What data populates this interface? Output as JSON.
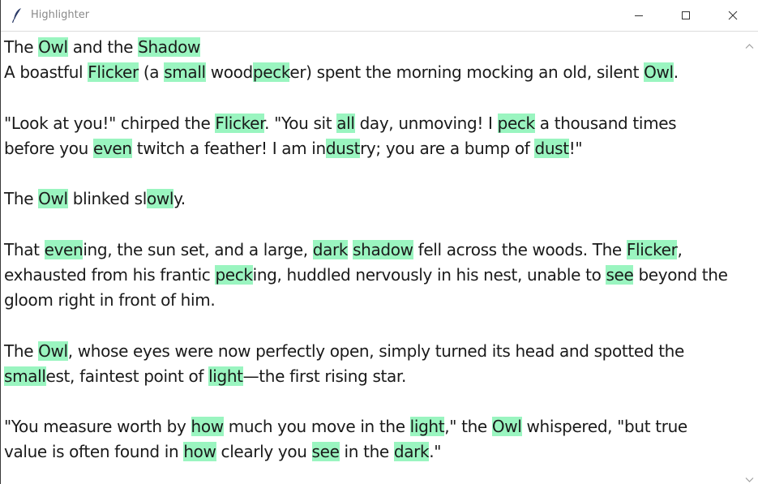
{
  "window": {
    "title": "Highlighter",
    "icon": "feather-icon",
    "highlight_color": "#9af5c0"
  },
  "lines": [
    {
      "segs": [
        {
          "t": "The ",
          "h": false
        },
        {
          "t": "Owl",
          "h": true
        },
        {
          "t": " and the ",
          "h": false
        },
        {
          "t": "Shadow",
          "h": true
        }
      ]
    },
    {
      "segs": [
        {
          "t": "A boastful ",
          "h": false
        },
        {
          "t": "Flicker",
          "h": true
        },
        {
          "t": " (a ",
          "h": false
        },
        {
          "t": "small",
          "h": true
        },
        {
          "t": " wood",
          "h": false
        },
        {
          "t": "peck",
          "h": true
        },
        {
          "t": "er) spent the morning mocking an old, silent ",
          "h": false
        },
        {
          "t": "Owl",
          "h": true
        },
        {
          "t": ".",
          "h": false
        }
      ]
    },
    {
      "segs": [
        {
          "t": "\"Look at you!\" chirped the ",
          "h": false
        },
        {
          "t": "Flicker",
          "h": true
        },
        {
          "t": ". \"You sit ",
          "h": false
        },
        {
          "t": "all",
          "h": true
        },
        {
          "t": " day, unmoving! I ",
          "h": false
        },
        {
          "t": "peck",
          "h": true
        },
        {
          "t": " a thousand times",
          "h": false
        }
      ]
    },
    {
      "segs": [
        {
          "t": "before you ",
          "h": false
        },
        {
          "t": "even",
          "h": true
        },
        {
          "t": " twitch a feather! I am in",
          "h": false
        },
        {
          "t": "dust",
          "h": true
        },
        {
          "t": "ry; you are a bump of ",
          "h": false
        },
        {
          "t": "dust",
          "h": true
        },
        {
          "t": "!\"",
          "h": false
        }
      ]
    },
    {
      "segs": [
        {
          "t": "The ",
          "h": false
        },
        {
          "t": "Owl",
          "h": true
        },
        {
          "t": " blinked sl",
          "h": false
        },
        {
          "t": "owl",
          "h": true
        },
        {
          "t": "y.",
          "h": false
        }
      ]
    },
    {
      "segs": [
        {
          "t": "That ",
          "h": false
        },
        {
          "t": "even",
          "h": true
        },
        {
          "t": "ing, the sun set, and a large, ",
          "h": false
        },
        {
          "t": "dark",
          "h": true
        },
        {
          "t": " ",
          "h": false
        },
        {
          "t": "shadow",
          "h": true
        },
        {
          "t": " fell across the woods. The ",
          "h": false
        },
        {
          "t": "Flicker",
          "h": true
        },
        {
          "t": ",",
          "h": false
        }
      ]
    },
    {
      "segs": [
        {
          "t": "exhausted from his frantic ",
          "h": false
        },
        {
          "t": "peck",
          "h": true
        },
        {
          "t": "ing, huddled nervously in his nest, unable to ",
          "h": false
        },
        {
          "t": "see",
          "h": true
        },
        {
          "t": " beyond the",
          "h": false
        }
      ]
    },
    {
      "segs": [
        {
          "t": "gloom right in front of him.",
          "h": false
        }
      ]
    },
    {
      "segs": [
        {
          "t": "The ",
          "h": false
        },
        {
          "t": "Owl",
          "h": true
        },
        {
          "t": ", whose eyes were now perfectly open, simply turned its head and spotted the",
          "h": false
        }
      ]
    },
    {
      "segs": [
        {
          "t": "small",
          "h": true
        },
        {
          "t": "est, faintest point of ",
          "h": false
        },
        {
          "t": "light",
          "h": true
        },
        {
          "t": "—the first rising star.",
          "h": false
        }
      ]
    },
    {
      "segs": [
        {
          "t": "\"You measure worth by ",
          "h": false
        },
        {
          "t": "how",
          "h": true
        },
        {
          "t": " much you move in the ",
          "h": false
        },
        {
          "t": "light",
          "h": true
        },
        {
          "t": ",\" the ",
          "h": false
        },
        {
          "t": "Owl",
          "h": true
        },
        {
          "t": " whispered, \"but true",
          "h": false
        }
      ]
    },
    {
      "segs": [
        {
          "t": "value is often found in ",
          "h": false
        },
        {
          "t": "how",
          "h": true
        },
        {
          "t": " clearly you ",
          "h": false
        },
        {
          "t": "see",
          "h": true
        },
        {
          "t": " in the ",
          "h": false
        },
        {
          "t": "dark",
          "h": true
        },
        {
          "t": ".\"",
          "h": false
        }
      ]
    }
  ]
}
